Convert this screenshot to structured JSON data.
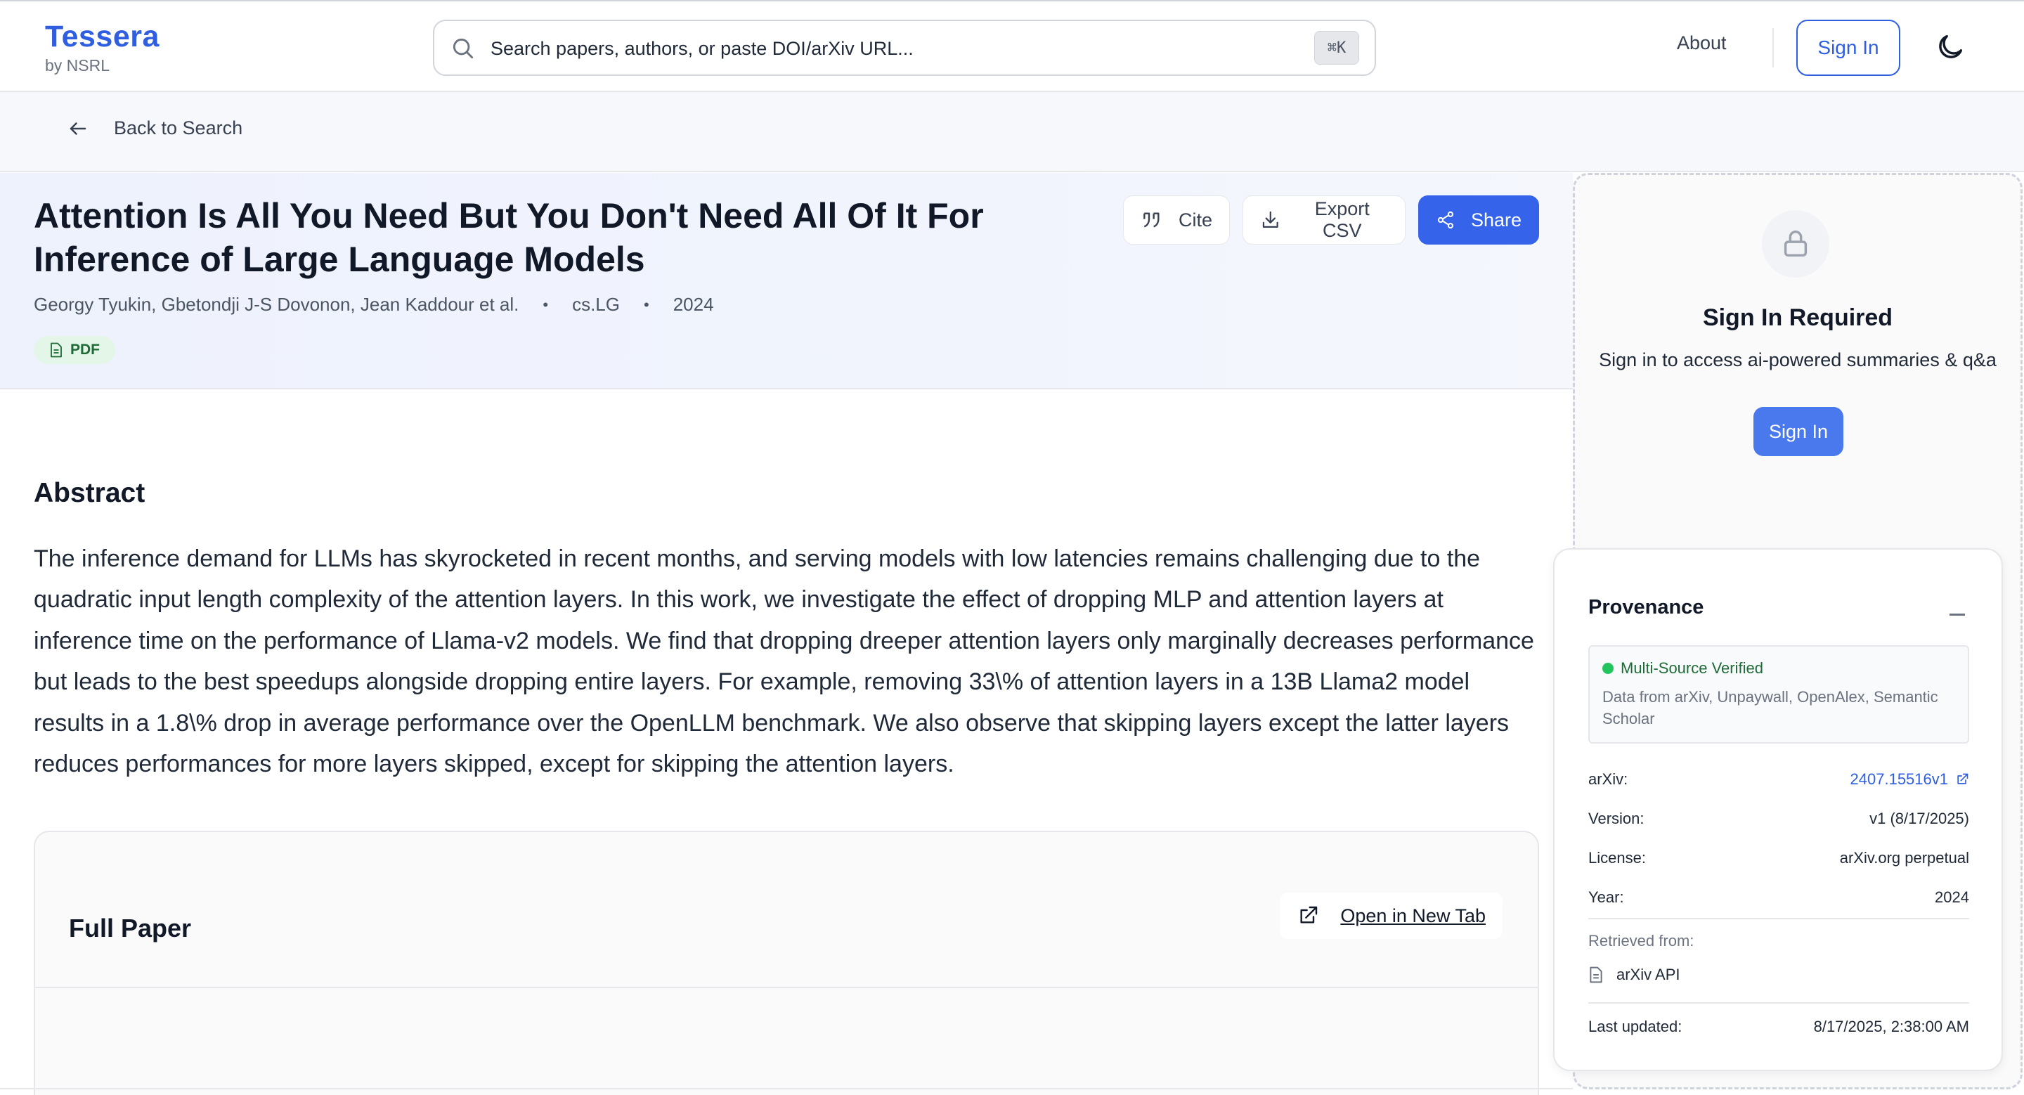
{
  "header": {
    "brand": "Tessera",
    "brand_sub": "by NSRL",
    "search_placeholder": "Search papers, authors, or paste DOI/arXiv URL...",
    "shortcut": "⌘K",
    "about": "About",
    "sign_in": "Sign In",
    "brand_color": "#2f5fe0"
  },
  "backbar": {
    "label": "Back to Search"
  },
  "paper": {
    "title": "Attention Is All You Need But You Don't Need All Of It For Inference of Large Language Models",
    "authors": "Georgy Tyukin, Gbetondji J-S Dovonon, Jean Kaddour et al.",
    "category": "cs.LG",
    "year": "2024",
    "badge": "PDF",
    "actions": {
      "cite": "Cite",
      "export": "Export CSV",
      "share": "Share"
    }
  },
  "abstract": {
    "heading": "Abstract",
    "text": "The inference demand for LLMs has skyrocketed in recent months, and serving models with low latencies remains challenging due to the quadratic input length complexity of the attention layers. In this work, we investigate the effect of dropping MLP and attention layers at inference time on the performance of Llama-v2 models. We find that dropping dreeper attention layers only marginally decreases performance but leads to the best speedups alongside dropping entire layers. For example, removing 33\\% of attention layers in a 13B Llama2 model results in a 1.8\\% drop in average performance over the OpenLLM benchmark. We also observe that skipping layers except the latter layers reduces performances for more layers skipped, except for skipping the attention layers."
  },
  "full_paper": {
    "heading": "Full Paper",
    "open_tab": "Open in New Tab"
  },
  "sidebar": {
    "signin_title": "Sign In Required",
    "signin_sub": "Sign in to access ai-powered summaries & q&a",
    "signin_button": "Sign In"
  },
  "provenance": {
    "title": "Provenance",
    "verified": "Multi-Source Verified",
    "verified_desc": "Data from arXiv, Unpaywall, OpenAlex, Semantic Scholar",
    "rows": [
      {
        "label": "arXiv:",
        "value": "2407.15516v1"
      },
      {
        "label": "Version:",
        "value": "v1 (8/17/2025)"
      },
      {
        "label": "License:",
        "value": "arXiv.org perpetual"
      },
      {
        "label": "Year:",
        "value": "2024"
      }
    ],
    "retrieved_label": "Retrieved from:",
    "source": "arXiv API",
    "updated_label": "Last updated:",
    "updated_value": "8/17/2025, 2:38:00 AM"
  }
}
